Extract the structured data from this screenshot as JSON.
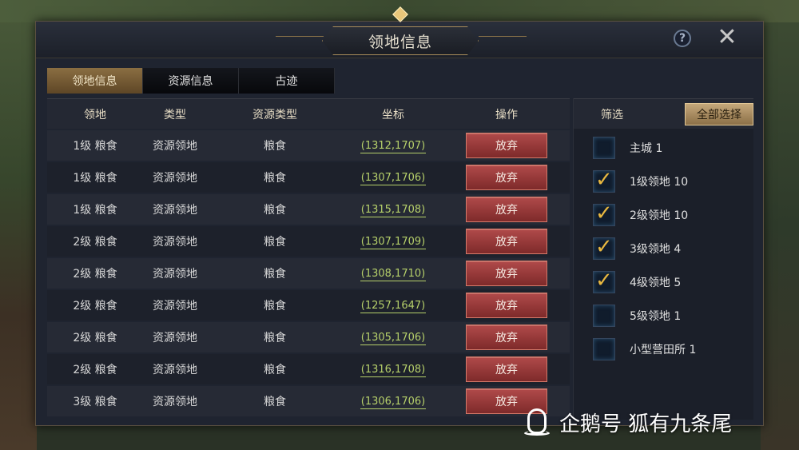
{
  "dialog": {
    "title": "领地信息",
    "help_glyph": "?",
    "close_glyph": "✕"
  },
  "tabs": [
    {
      "label": "领地信息",
      "active": true
    },
    {
      "label": "资源信息",
      "active": false
    },
    {
      "label": "古迹",
      "active": false
    }
  ],
  "table": {
    "headers": [
      "领地",
      "类型",
      "资源类型",
      "坐标",
      "操作"
    ],
    "rows": [
      {
        "territory": "1级  粮食",
        "type": "资源领地",
        "resource": "粮食",
        "coord": "(1312,1707)",
        "action": "放弃"
      },
      {
        "territory": "1级  粮食",
        "type": "资源领地",
        "resource": "粮食",
        "coord": "(1307,1706)",
        "action": "放弃"
      },
      {
        "territory": "1级  粮食",
        "type": "资源领地",
        "resource": "粮食",
        "coord": "(1315,1708)",
        "action": "放弃"
      },
      {
        "territory": "2级  粮食",
        "type": "资源领地",
        "resource": "粮食",
        "coord": "(1307,1709)",
        "action": "放弃"
      },
      {
        "territory": "2级  粮食",
        "type": "资源领地",
        "resource": "粮食",
        "coord": "(1308,1710)",
        "action": "放弃"
      },
      {
        "territory": "2级  粮食",
        "type": "资源领地",
        "resource": "粮食",
        "coord": "(1257,1647)",
        "action": "放弃"
      },
      {
        "territory": "2级  粮食",
        "type": "资源领地",
        "resource": "粮食",
        "coord": "(1305,1706)",
        "action": "放弃"
      },
      {
        "territory": "2级  粮食",
        "type": "资源领地",
        "resource": "粮食",
        "coord": "(1316,1708)",
        "action": "放弃"
      },
      {
        "territory": "3级  粮食",
        "type": "资源领地",
        "resource": "粮食",
        "coord": "(1306,1706)",
        "action": "放弃"
      }
    ]
  },
  "filter": {
    "title": "筛选",
    "select_all": "全部选择",
    "items": [
      {
        "label": "主城  1",
        "checked": false
      },
      {
        "label": "1级领地  10",
        "checked": true
      },
      {
        "label": "2级领地  10",
        "checked": true
      },
      {
        "label": "3级领地  4",
        "checked": true
      },
      {
        "label": "4级领地  5",
        "checked": true
      },
      {
        "label": "5级领地  1",
        "checked": false
      },
      {
        "label": "小型营田所  1",
        "checked": false
      }
    ]
  },
  "watermark": {
    "text": "企鹅号 狐有九条尾"
  },
  "colors": {
    "accent_gold": "#a88c5a",
    "abandon_red": "#b04a4a",
    "coord_green": "#b6d06a",
    "check_gold": "#e8b840"
  }
}
